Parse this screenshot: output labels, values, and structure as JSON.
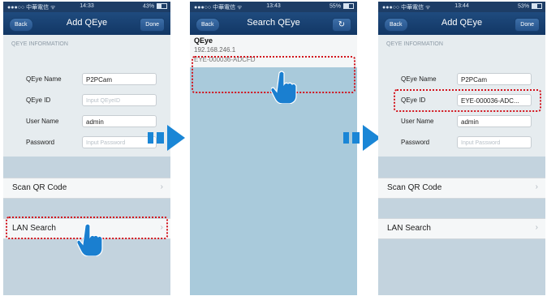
{
  "status": {
    "carrier": "●●●○○ 中華電信 ᯤ",
    "batt_icon": "battery-icon",
    "p1": {
      "time": "14:33",
      "battery": "43%",
      "battery_level": 0.43
    },
    "p2": {
      "time": "13:43",
      "battery": "55%",
      "battery_level": 0.55
    },
    "p3": {
      "time": "13:44",
      "battery": "53%",
      "battery_level": 0.53
    }
  },
  "nav": {
    "back": "Back",
    "done": "Done",
    "add_title": "Add QEye",
    "search_title": "Search QEye",
    "refresh_glyph": "↻"
  },
  "form": {
    "section": "QEYE INFORMATION",
    "name_label": "QEye Name",
    "id_label": "QEye ID",
    "user_label": "User Name",
    "pass_label": "Password",
    "name_value": "P2PCam",
    "id_placeholder": "Input QEyeID",
    "user_value": "admin",
    "pass_placeholder": "Input Password",
    "id_value_filled": "EYE-000036-ADC..."
  },
  "cells": {
    "scan": "Scan QR Code",
    "lan": "LAN Search",
    "chevron": "›"
  },
  "search": {
    "name": "QEye",
    "ip": "192.168.246.1",
    "id": "EYE-000036-ADCFD"
  },
  "colors": {
    "nav_blue": "#1f4b7e",
    "highlight_red": "#d2131c",
    "arrow_blue": "#1a86d6"
  }
}
